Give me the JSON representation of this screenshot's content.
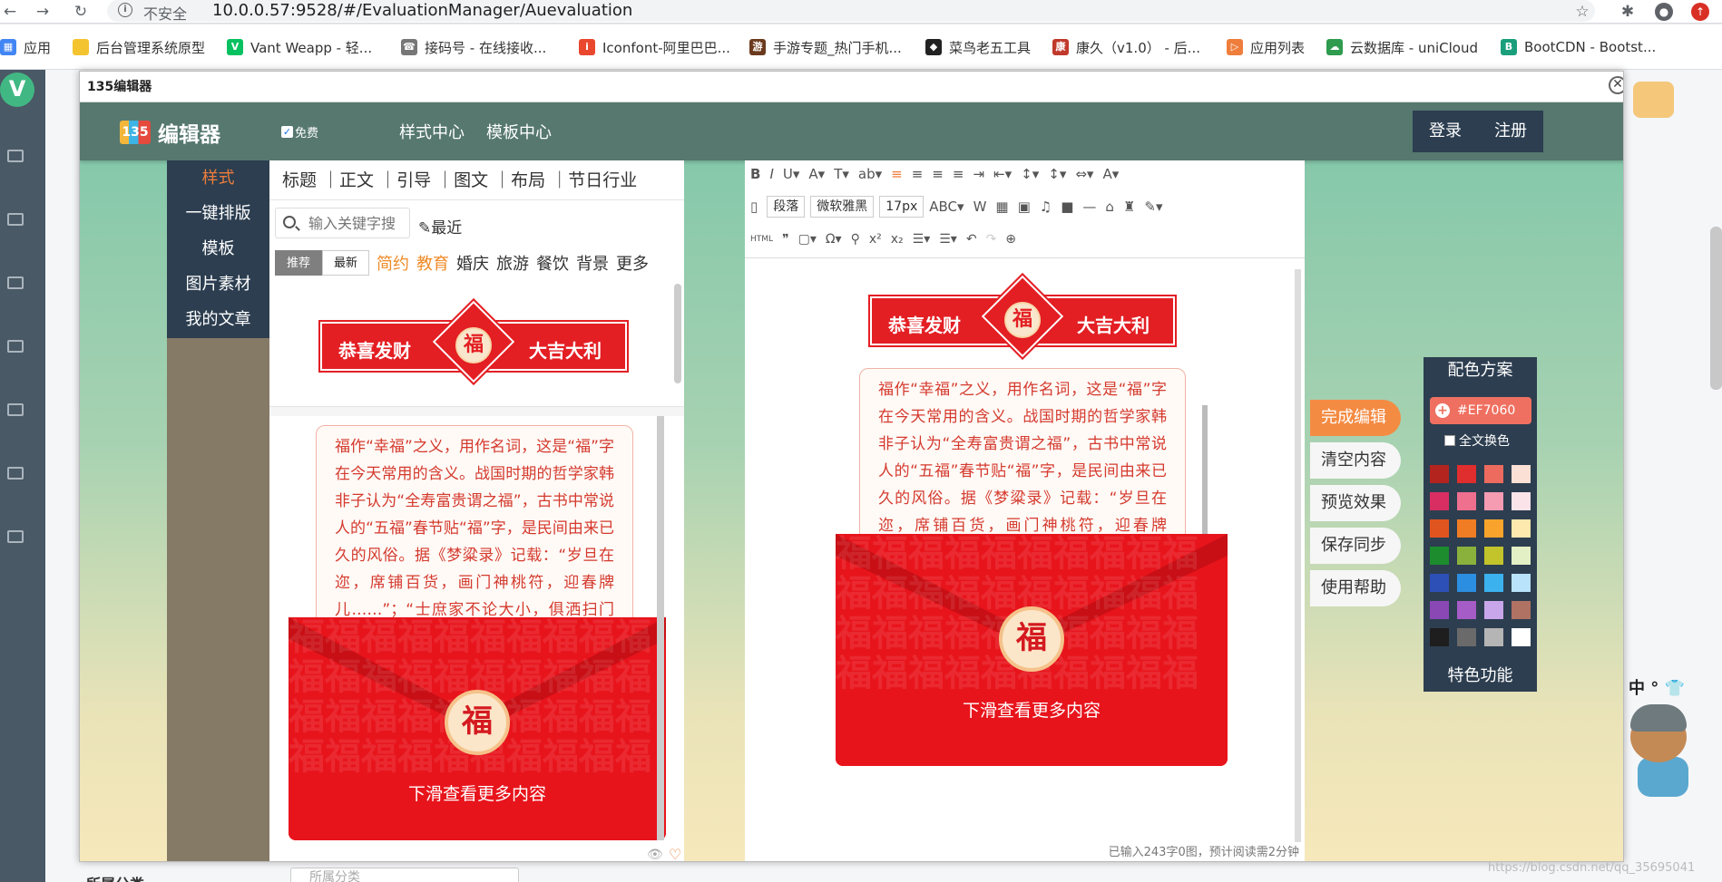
{
  "browser": {
    "insecure_label": "不安全",
    "url": "10.0.0.57:9528/#/EvaluationManager/Auevaluation"
  },
  "bookmarks": [
    {
      "label": "应用",
      "color": "#4285f4"
    },
    {
      "label": "后台管理系统原型",
      "color": "#f4c430"
    },
    {
      "label": "Vant Weapp - 轻...",
      "color": "#07c160"
    },
    {
      "label": "接码号 - 在线接收...",
      "color": "#777777"
    },
    {
      "label": "Iconfont-阿里巴巴...",
      "color": "#e9472e"
    },
    {
      "label": "手游专题_热门手机...",
      "color": "#6b3a1e"
    },
    {
      "label": "菜鸟老五工具",
      "color": "#222222"
    },
    {
      "label": "康久（v1.0） - 后...",
      "color": "#c0392b"
    },
    {
      "label": "应用列表",
      "color": "#ef7d3c"
    },
    {
      "label": "云数据库 - uniCloud",
      "color": "#2e9b4e"
    },
    {
      "label": "BootCDN - Bootst...",
      "color": "#1a9e7b"
    }
  ],
  "underlying": {
    "bottom_label": "所属分类",
    "bottom_placeholder": "所属分类"
  },
  "dialog": {
    "title": "135编辑器",
    "close_glyph": "✕"
  },
  "topbar": {
    "logo_text": "编辑器",
    "logo_mark": "135",
    "free_label": "免费",
    "nav": [
      "样式中心",
      "模板中心"
    ],
    "login": "登录",
    "register": "注册"
  },
  "leftnav": [
    "样式",
    "一键排版",
    "模板",
    "图片素材",
    "我的文章"
  ],
  "materials": {
    "categories": "标题 ｜正文 ｜引导 ｜图文 ｜布局 ｜节日行业",
    "search_placeholder": "输入关键字搜",
    "recent_label": "最近",
    "tabs": [
      "推荐",
      "最新"
    ],
    "tags_highlight": [
      "简约",
      "教育"
    ],
    "tags": [
      "婚庆",
      "旅游",
      "餐饮",
      "背景",
      "更多"
    ]
  },
  "banner": {
    "left_text": "恭喜发财",
    "center_text": "福",
    "right_text": "大吉大利"
  },
  "letter": {
    "paragraph": "福作“幸福”之义，用作名词，这是“福”字在今天常用的含义。战国时期的哲学家韩非子认为“全寿富贵谓之福”，古书中常说人的“五福”春节贴“福”字，是民间由来已久的风俗。据《梦粱录》记载：“岁旦在迩，席铺百货，画门神桃符，迎春牌儿……”；“士庶家不论大小，俱洒扫门间，去尘秽，净庭户，换门神，挂钟馗，钉桃符，贴春牌”",
    "seal": "福",
    "caption": "下滑查看更多内容"
  },
  "editor": {
    "toolbar_row1": [
      "B",
      "I",
      "U▾",
      "A▾",
      "T▾",
      "ab▾",
      "≡",
      "≡",
      "≡",
      "≡",
      "⇥",
      "⇤▾",
      "↕▾",
      "↕▾",
      "⇔▾",
      "A▾"
    ],
    "paragraph_select": "段落",
    "font_select": "微软雅黑",
    "size_select": "17px",
    "toolbar_row2": [
      "ABC▾",
      "W",
      "▦",
      "▣",
      "♫",
      "■",
      "—",
      "⌂",
      "♜",
      "✎▾"
    ],
    "toolbar_row3": [
      "HTML",
      "❞",
      "▢▾",
      "Ω▾",
      "⚲",
      "x²",
      "x₂",
      "☰▾",
      "☰▾",
      "↶",
      "↷",
      "⊕"
    ],
    "status": "已输入243字0图，预计阅读需2分钟"
  },
  "actions": [
    "完成编辑",
    "清空内容",
    "预览效果",
    "保存同步",
    "使用帮助"
  ],
  "palette": {
    "title": "配色方案",
    "current": "#EF7060",
    "all_label": "全文换色",
    "footer": "特色功能",
    "swatches": [
      "#b3241f",
      "#e02d2d",
      "#ec6a5e",
      "#fbe0d5",
      "#d82e61",
      "#ef6f8f",
      "#f59bb2",
      "#fbe3ea",
      "#e0551f",
      "#f07c23",
      "#f7a32c",
      "#fde8ad",
      "#1c8c2e",
      "#89b13c",
      "#c3c32b",
      "#e3efc4",
      "#2c50b6",
      "#2c8ee0",
      "#3bb2ee",
      "#b9e3fb",
      "#8a48b4",
      "#a65cc6",
      "#c9a6ea",
      "#b07262",
      "#1e1e1e",
      "#6a6a6a",
      "#b5b5b5",
      "#ffffff"
    ]
  },
  "mascot": {
    "tag": "中 ° 👕"
  },
  "watermark": "https://blog.csdn.net/qq_35695041"
}
